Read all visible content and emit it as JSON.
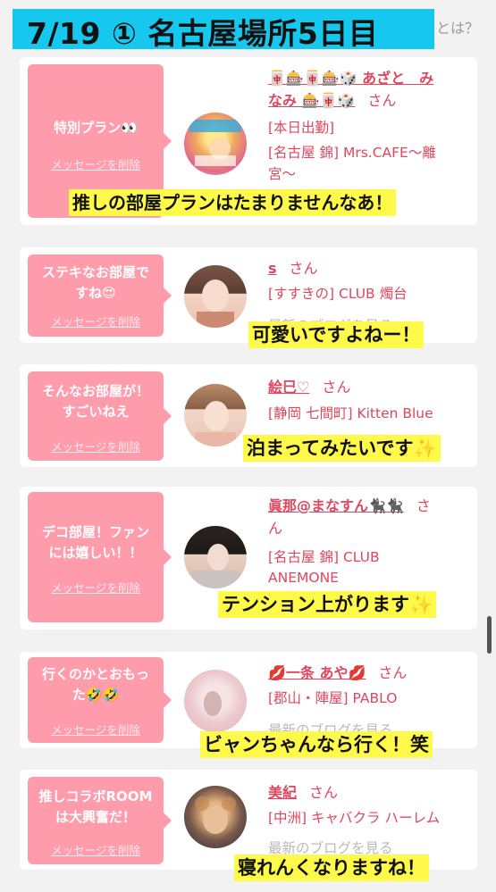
{
  "header": {
    "title": "7/19 ① 名古屋場所5日目",
    "ghost_text": "とは？"
  },
  "cards": [
    {
      "bubble": {
        "lines": [
          "特別プラン👀"
        ],
        "delete": "メッセージを削除"
      },
      "name_lines": [
        "🀄🎰🀄🎰🎲 あざと　み",
        "なみ 🎰🀄🎲"
      ],
      "san": "さん",
      "lines": [
        "[本日出勤]",
        "[名古屋 錦] Mrs.CAFE〜離",
        "宮〜"
      ],
      "caption": "推しの部屋プランはたまりませんなあ！"
    },
    {
      "bubble": {
        "lines": [
          "ステキなお部屋で",
          "すね😍"
        ],
        "delete": "メッセージを削除"
      },
      "name_lines": [
        "s"
      ],
      "san": "さん",
      "lines": [
        "[すすきの] CLUB 燭台",
        "最新のブログを見る"
      ],
      "caption": "可愛いですよねー！"
    },
    {
      "bubble": {
        "lines": [
          "そんなお部屋が！",
          "すごいねえ"
        ],
        "delete": "メッセージを削除"
      },
      "name_lines": [
        "絵巳♡"
      ],
      "san": "さん",
      "lines": [
        "[静岡 七間町] Kitten Blue"
      ],
      "caption": "泊まってみたいです✨"
    },
    {
      "bubble": {
        "lines": [
          "デコ部屋！ファン",
          "には嬉しい！！"
        ],
        "delete": "メッセージを削除"
      },
      "name_lines": [
        "眞那@まなすん🐈‍⬛🐈‍⬛",
        ""
      ],
      "san": "さ",
      "san2": "ん",
      "lines": [
        "[名古屋 錦] CLUB",
        "ANEMONE"
      ],
      "caption": "テンション上がります✨"
    },
    {
      "bubble": {
        "lines": [
          "行くのかとおもっ",
          "た🤣🤣"
        ],
        "delete": "メッセージを削除"
      },
      "name_lines": [
        "💋一条 あや💋"
      ],
      "san": "さん",
      "lines": [
        "[郡山・陣屋] PABLO",
        "最新のブログを見る"
      ],
      "caption": "ビャンちゃんなら行く！笑"
    },
    {
      "bubble": {
        "lines": [
          "推しコラボROOM",
          "は大興奮だ！"
        ],
        "delete": "メッセージを削除"
      },
      "name_lines": [
        "美紀"
      ],
      "san": "さん",
      "lines": [
        "[中洲] キャバクラ ハーレム",
        "最新のブログを見る"
      ],
      "caption": "寝れんくなりますね！"
    }
  ],
  "colors": {
    "accent": "#e0465e",
    "bubble": "#ff9cac",
    "title_band": "#16c8ee",
    "caption_bg": "#fff949"
  }
}
